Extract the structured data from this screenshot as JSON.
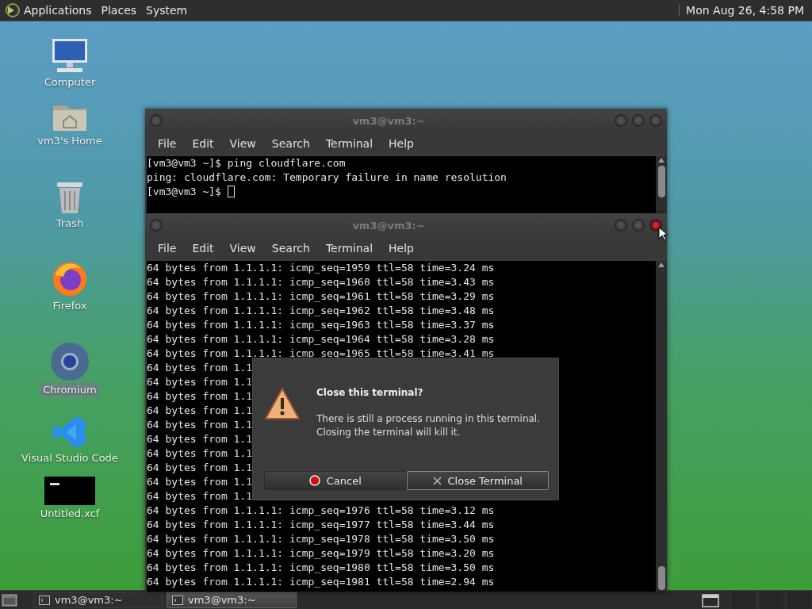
{
  "top_panel": {
    "menus": [
      "Applications",
      "Places",
      "System"
    ],
    "clock": "Mon Aug 26,  4:58 PM"
  },
  "desktop_icons": [
    {
      "label": "Computer",
      "kind": "computer",
      "selected": false
    },
    {
      "label": "vm3's Home",
      "kind": "home",
      "selected": false
    },
    {
      "label": "Trash",
      "kind": "trash",
      "selected": false
    },
    {
      "label": "Firefox",
      "kind": "firefox",
      "selected": false
    },
    {
      "label": "Chromium",
      "kind": "chromium",
      "selected": true
    },
    {
      "label": "Visual Studio Code",
      "kind": "vscode",
      "selected": false
    },
    {
      "label": "Untitled.xcf",
      "kind": "image",
      "selected": false
    }
  ],
  "windows": [
    {
      "title": "vm3@vm3:~",
      "menu": [
        "File",
        "Edit",
        "View",
        "Search",
        "Terminal",
        "Help"
      ],
      "close_hovered": false,
      "cursor": true,
      "lines": [
        "[vm3@vm3 ~]$ ping cloudflare.com",
        "ping: cloudflare.com: Temporary failure in name resolution",
        "[vm3@vm3 ~]$ "
      ]
    },
    {
      "title": "vm3@vm3:~",
      "menu": [
        "File",
        "Edit",
        "View",
        "Search",
        "Terminal",
        "Help"
      ],
      "close_hovered": true,
      "cursor": false,
      "lines": [
        "64 bytes from 1.1.1.1: icmp_seq=1959 ttl=58 time=3.24 ms",
        "64 bytes from 1.1.1.1: icmp_seq=1960 ttl=58 time=3.43 ms",
        "64 bytes from 1.1.1.1: icmp_seq=1961 ttl=58 time=3.29 ms",
        "64 bytes from 1.1.1.1: icmp_seq=1962 ttl=58 time=3.48 ms",
        "64 bytes from 1.1.1.1: icmp_seq=1963 ttl=58 time=3.37 ms",
        "64 bytes from 1.1.1.1: icmp_seq=1964 ttl=58 time=3.28 ms",
        "64 bytes from 1.1.1.1: icmp_seq=1965 ttl=58 time=3.41 ms",
        "64 bytes from 1.1",
        "64 bytes from 1.1",
        "64 bytes from 1.1",
        "64 bytes from 1.1",
        "64 bytes from 1.1",
        "64 bytes from 1.1",
        "64 bytes from 1.1",
        "64 bytes from 1.1",
        "64 bytes from 1.1",
        "64 bytes from 1.1",
        "64 bytes from 1.1.1.1: icmp_seq=1976 ttl=58 time=3.12 ms",
        "64 bytes from 1.1.1.1: icmp_seq=1977 ttl=58 time=3.44 ms",
        "64 bytes from 1.1.1.1: icmp_seq=1978 ttl=58 time=3.50 ms",
        "64 bytes from 1.1.1.1: icmp_seq=1979 ttl=58 time=3.20 ms",
        "64 bytes from 1.1.1.1: icmp_seq=1980 ttl=58 time=3.50 ms",
        "64 bytes from 1.1.1.1: icmp_seq=1981 ttl=58 time=2.94 ms"
      ]
    }
  ],
  "dialog": {
    "title": "Close this terminal?",
    "message": [
      "There is still a process running in this terminal.",
      "Closing the terminal will kill it."
    ],
    "buttons": [
      {
        "label": "Cancel",
        "kind": "cancel",
        "focused": false
      },
      {
        "label": "Close Terminal",
        "kind": "close",
        "focused": true
      }
    ]
  },
  "taskbar": {
    "tasks": [
      {
        "label": "vm3@vm3:~",
        "selected": false
      },
      {
        "label": "vm3@vm3:~",
        "selected": true
      }
    ]
  }
}
